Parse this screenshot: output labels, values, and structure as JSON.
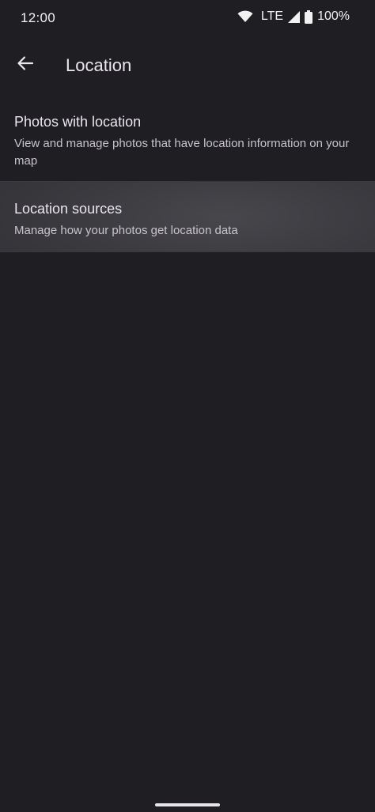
{
  "status_bar": {
    "time": "12:00",
    "network": "LTE",
    "battery": "100%",
    "icons": [
      "wifi-icon",
      "cell-signal-icon",
      "battery-icon"
    ]
  },
  "app_bar": {
    "title": "Location",
    "back_icon": "arrow-back-icon"
  },
  "settings": {
    "items": [
      {
        "title": "Photos with location",
        "subtitle": "View and manage photos that have location information on your map"
      },
      {
        "title": "Location sources",
        "subtitle": "Manage how your photos get location data"
      }
    ]
  },
  "colors": {
    "background": "#1f1e22",
    "highlight": "#403f44",
    "text_primary": "#ece6ee",
    "text_secondary": "#c8c3cc"
  }
}
